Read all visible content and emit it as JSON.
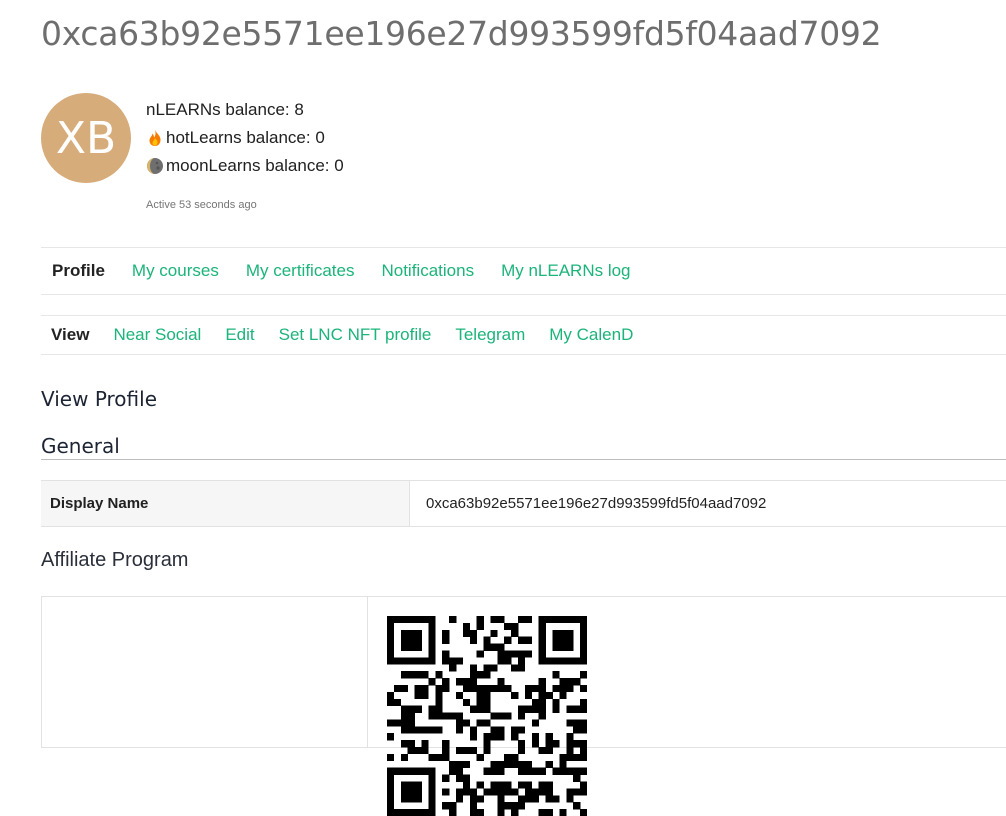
{
  "page": {
    "title": "0xca63b92e5571ee196e27d993599fd5f04aad7092"
  },
  "user": {
    "avatar_initials": "XB",
    "avatar_color": "#d7ac7b",
    "balances": {
      "nlearns": "nLEARNs balance: 8",
      "hotlearns": "hotLearns balance: 0",
      "moonlearns": "moonLearns balance: 0"
    },
    "active": "Active 53 seconds ago"
  },
  "primary_tabs": [
    {
      "label": "Profile",
      "active": true
    },
    {
      "label": "My courses"
    },
    {
      "label": "My certificates"
    },
    {
      "label": "Notifications"
    },
    {
      "label": "My nLEARNs log"
    }
  ],
  "secondary_tabs": [
    {
      "label": "View",
      "active": true
    },
    {
      "label": "Near Social"
    },
    {
      "label": "Edit"
    },
    {
      "label": "Set LNC NFT profile"
    },
    {
      "label": "Telegram"
    },
    {
      "label": "My CalenD"
    }
  ],
  "profile": {
    "heading": "View Profile",
    "general_heading": "General",
    "display_name_label": "Display Name",
    "display_name_value": "0xca63b92e5571ee196e27d993599fd5f04aad7092",
    "affiliate_heading": "Affiliate Program"
  },
  "colors": {
    "accent": "#1bb47a",
    "title_gray": "#6e6e6e"
  },
  "icons": {
    "hotlearns": "fire-icon",
    "moonlearns": "moon-icon",
    "affiliate_code": "qr-code-icon"
  }
}
